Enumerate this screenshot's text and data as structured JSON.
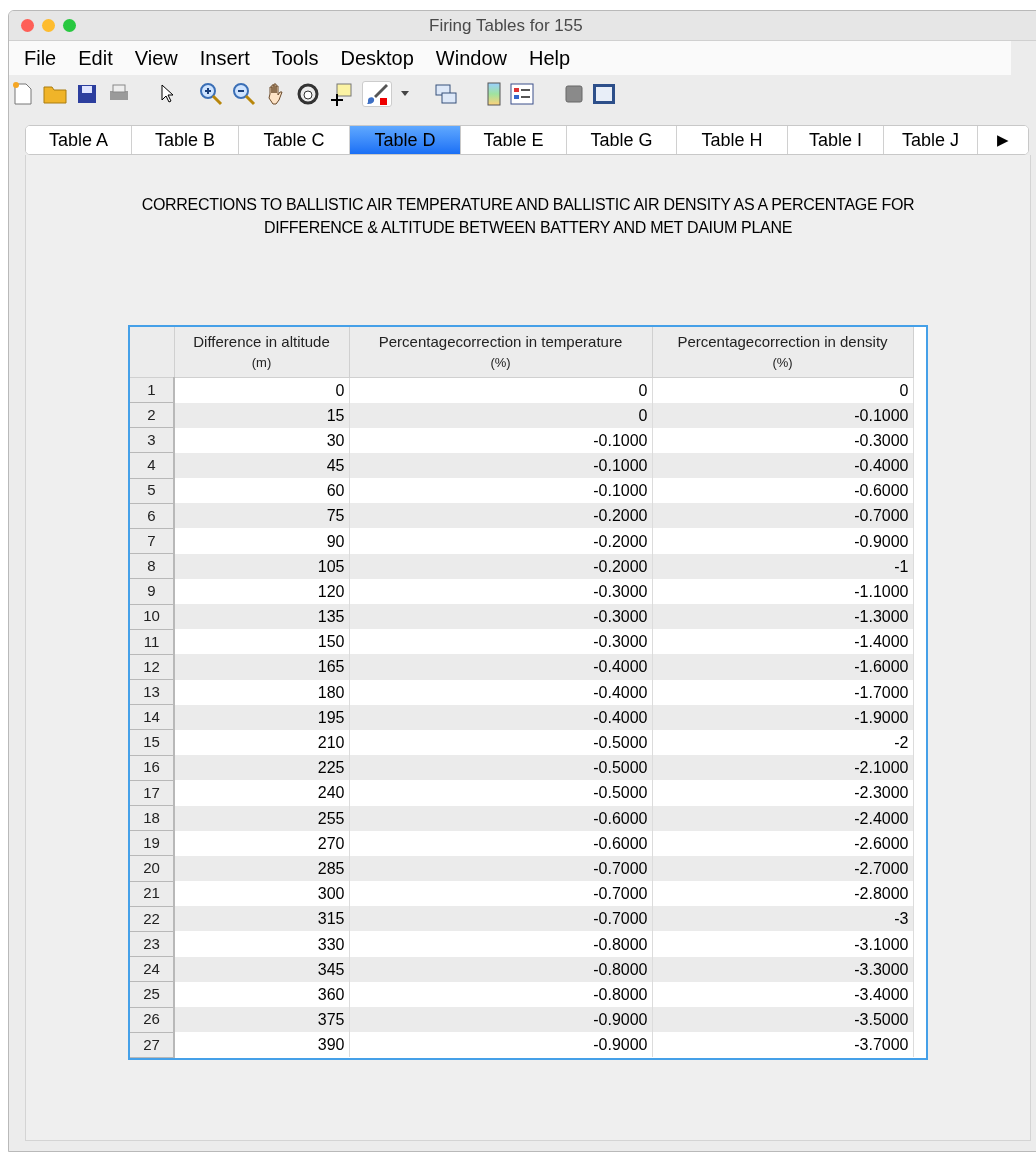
{
  "window": {
    "title": "Firing Tables for 155"
  },
  "menu": [
    "File",
    "Edit",
    "View",
    "Insert",
    "Tools",
    "Desktop",
    "Window",
    "Help"
  ],
  "tabs": [
    {
      "label": "Table A",
      "selected": false
    },
    {
      "label": "Table B",
      "selected": false
    },
    {
      "label": "Table C",
      "selected": false
    },
    {
      "label": "Table D",
      "selected": true
    },
    {
      "label": "Table E",
      "selected": false
    },
    {
      "label": "Table G",
      "selected": false
    },
    {
      "label": "Table H",
      "selected": false
    },
    {
      "label": "Table I",
      "selected": false
    },
    {
      "label": "Table J",
      "selected": false
    }
  ],
  "tab_scroll": "▶",
  "heading_lines": [
    "CORRECTIONS  TO BALLISTIC AIR TEMPERATURE AND BALLISTIC AIR DENSITY AS A PERCENTAGE FOR",
    "DIFFERENCE & ALTITUDE BETWEEN BATTERY AND MET DAIUM PLANE"
  ],
  "table": {
    "columns": [
      {
        "label": "Difference in altitude",
        "unit": "(m)"
      },
      {
        "label": "Percentagecorrection in temperature",
        "unit": "(%)"
      },
      {
        "label": "Percentagecorrection in density",
        "unit": "(%)"
      }
    ],
    "rows": [
      {
        "row_label": "1",
        "cells": [
          "0",
          "0",
          "0"
        ]
      },
      {
        "row_label": "2",
        "cells": [
          "15",
          "0",
          "-0.1000"
        ]
      },
      {
        "row_label": "3",
        "cells": [
          "30",
          "-0.1000",
          "-0.3000"
        ]
      },
      {
        "row_label": "4",
        "cells": [
          "45",
          "-0.1000",
          "-0.4000"
        ]
      },
      {
        "row_label": "5",
        "cells": [
          "60",
          "-0.1000",
          "-0.6000"
        ]
      },
      {
        "row_label": "6",
        "cells": [
          "75",
          "-0.2000",
          "-0.7000"
        ]
      },
      {
        "row_label": "7",
        "cells": [
          "90",
          "-0.2000",
          "-0.9000"
        ]
      },
      {
        "row_label": "8",
        "cells": [
          "105",
          "-0.2000",
          "-1"
        ]
      },
      {
        "row_label": "9",
        "cells": [
          "120",
          "-0.3000",
          "-1.1000"
        ]
      },
      {
        "row_label": "10",
        "cells": [
          "135",
          "-0.3000",
          "-1.3000"
        ]
      },
      {
        "row_label": "11",
        "cells": [
          "150",
          "-0.3000",
          "-1.4000"
        ]
      },
      {
        "row_label": "12",
        "cells": [
          "165",
          "-0.4000",
          "-1.6000"
        ]
      },
      {
        "row_label": "13",
        "cells": [
          "180",
          "-0.4000",
          "-1.7000"
        ]
      },
      {
        "row_label": "14",
        "cells": [
          "195",
          "-0.4000",
          "-1.9000"
        ]
      },
      {
        "row_label": "15",
        "cells": [
          "210",
          "-0.5000",
          "-2"
        ]
      },
      {
        "row_label": "16",
        "cells": [
          "225",
          "-0.5000",
          "-2.1000"
        ]
      },
      {
        "row_label": "17",
        "cells": [
          "240",
          "-0.5000",
          "-2.3000"
        ]
      },
      {
        "row_label": "18",
        "cells": [
          "255",
          "-0.6000",
          "-2.4000"
        ]
      },
      {
        "row_label": "19",
        "cells": [
          "270",
          "-0.6000",
          "-2.6000"
        ]
      },
      {
        "row_label": "20",
        "cells": [
          "285",
          "-0.7000",
          "-2.7000"
        ]
      },
      {
        "row_label": "21",
        "cells": [
          "300",
          "-0.7000",
          "-2.8000"
        ]
      },
      {
        "row_label": "22",
        "cells": [
          "315",
          "-0.7000",
          "-3"
        ]
      },
      {
        "row_label": "23",
        "cells": [
          "330",
          "-0.8000",
          "-3.1000"
        ]
      },
      {
        "row_label": "24",
        "cells": [
          "345",
          "-0.8000",
          "-3.3000"
        ]
      },
      {
        "row_label": "25",
        "cells": [
          "360",
          "-0.8000",
          "-3.4000"
        ]
      },
      {
        "row_label": "26",
        "cells": [
          "375",
          "-0.9000",
          "-3.5000"
        ]
      },
      {
        "row_label": "27",
        "cells": [
          "390",
          "-0.9000",
          "-3.7000"
        ]
      }
    ]
  }
}
